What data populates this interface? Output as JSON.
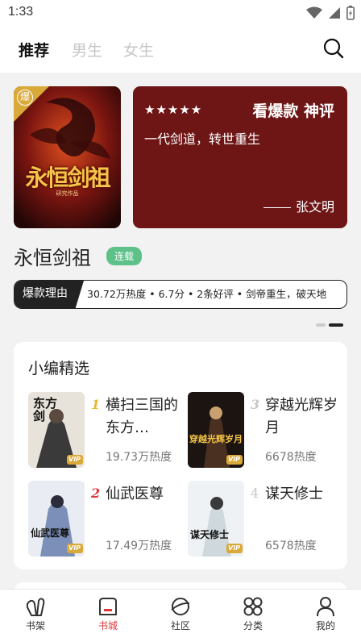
{
  "status_bar": {
    "time": "1:33"
  },
  "top_nav": {
    "tabs": [
      {
        "label": "推荐",
        "active": true
      },
      {
        "label": "男生",
        "active": false
      },
      {
        "label": "女生",
        "active": false
      }
    ]
  },
  "feature": {
    "cover_badge": "爆",
    "cover_title": "永恒剑祖",
    "cover_author": "研究作品",
    "review": {
      "stars": "★★★★★",
      "label": "看爆款 神评",
      "quote": "一代剑道，转世重生",
      "author": "张文明"
    },
    "book_title": "永恒剑祖",
    "status_tag": "连载",
    "reason_label": "爆款理由",
    "reason_text": "30.72万热度 • 6.7分 • 2条好评 • 剑帝重生，破天地"
  },
  "picks": {
    "title": "小编精选",
    "items": [
      {
        "rank": "1",
        "name": "横扫三国的东方…",
        "heat": "19.73万热度",
        "cover_text": "东方剑"
      },
      {
        "rank": "3",
        "name": "穿越光辉岁月",
        "heat": "6678热度",
        "cover_text": "穿越光辉岁月"
      },
      {
        "rank": "2",
        "name": "仙武医尊",
        "heat": "17.49万热度",
        "cover_text": "仙武医尊"
      },
      {
        "rank": "4",
        "name": "谋天修士",
        "heat": "6578热度",
        "cover_text": "谋天修士"
      }
    ],
    "vip_label": "VIP"
  },
  "bottom_tabs": [
    {
      "label": "书架",
      "icon": "bookshelf-icon",
      "active": false
    },
    {
      "label": "书城",
      "icon": "bookstore-icon",
      "active": true
    },
    {
      "label": "社区",
      "icon": "community-icon",
      "active": false
    },
    {
      "label": "分类",
      "icon": "category-icon",
      "active": false
    },
    {
      "label": "我的",
      "icon": "profile-icon",
      "active": false
    }
  ],
  "colors": {
    "accent": "#e0373b",
    "review_bg": "#6e1616",
    "tag_green": "#5ec18a"
  }
}
